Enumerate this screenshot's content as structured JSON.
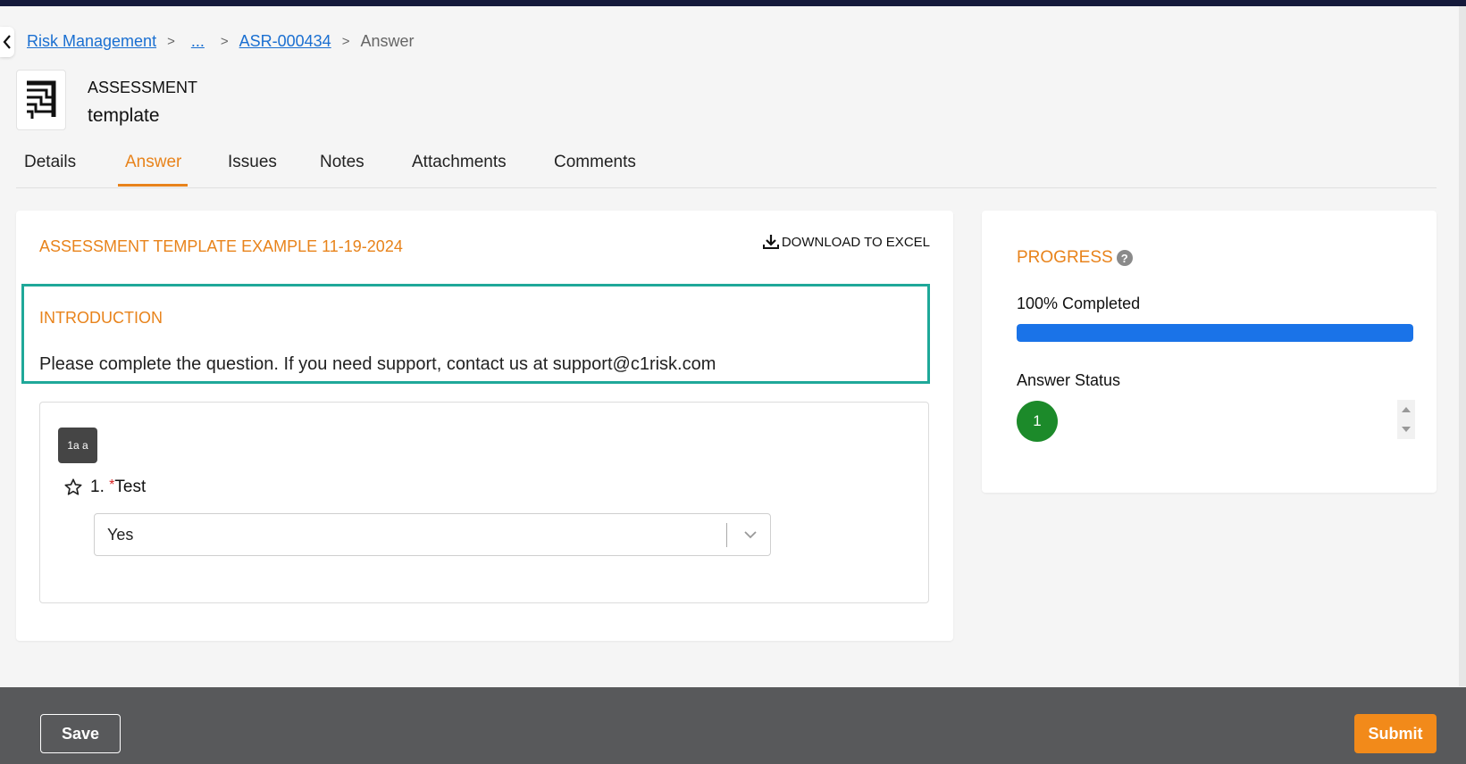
{
  "breadcrumb": {
    "items": [
      {
        "label": "Risk Management"
      },
      {
        "label": "..."
      },
      {
        "label": "ASR-000434"
      },
      {
        "label": "Answer"
      }
    ],
    "separator": ">"
  },
  "record": {
    "type": "ASSESSMENT",
    "name": "template"
  },
  "tabs": [
    {
      "label": "Details"
    },
    {
      "label": "Answer",
      "active": true
    },
    {
      "label": "Issues"
    },
    {
      "label": "Notes"
    },
    {
      "label": "Attachments"
    },
    {
      "label": "Comments"
    }
  ],
  "main": {
    "title": "ASSESSMENT TEMPLATE EXAMPLE 11-19-2024",
    "download_label": "DOWNLOAD TO EXCEL",
    "intro": {
      "title": "INTRODUCTION",
      "text": "Please complete the question. If you need support, contact us at support@c1risk.com"
    },
    "question": {
      "badge": "1a a",
      "number": "1.",
      "required_marker": "*",
      "label": "Test",
      "answer": "Yes"
    }
  },
  "progress": {
    "title": "PROGRESS",
    "help": "?",
    "completed_label": "100% Completed",
    "percent": 100,
    "status_label": "Answer Status",
    "status_count": "1"
  },
  "footer": {
    "save_label": "Save",
    "submit_label": "Submit"
  },
  "colors": {
    "accent": "#e8831b",
    "highlight_border": "#1fa899",
    "progress_fill": "#1a73e8",
    "status_green": "#1c8a2a",
    "submit": "#f28a1a",
    "footer_bg": "#58595b"
  },
  "icons": [
    "back-chevron-icon",
    "assessment-logo-icon",
    "download-icon",
    "star-outline-icon",
    "chevron-down-icon",
    "help-icon"
  ]
}
